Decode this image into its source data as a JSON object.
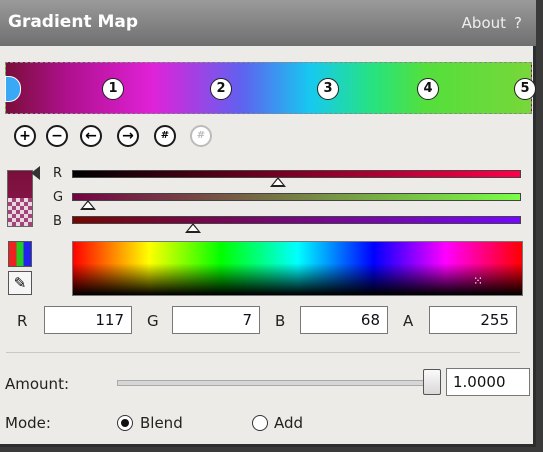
{
  "titlebar": {
    "title": "Gradient Map",
    "about": "About",
    "help": "?"
  },
  "gradient": {
    "stops": [
      "1",
      "2",
      "3",
      "4",
      "5"
    ]
  },
  "toolbar": {
    "icons": [
      "add-stop-icon",
      "remove-stop-icon",
      "move-left-icon",
      "move-right-icon",
      "distribute-icon",
      "disabled-icon"
    ]
  },
  "channels": {
    "r_label": "R",
    "g_label": "G",
    "b_label": "B"
  },
  "rgba": {
    "r_label": "R",
    "r_value": "117",
    "g_label": "G",
    "g_value": "7",
    "b_label": "B",
    "b_value": "68",
    "a_label": "A",
    "a_value": "255"
  },
  "amount": {
    "label": "Amount:",
    "value": "1.0000",
    "slider_fraction": 1.0
  },
  "mode": {
    "label": "Mode:",
    "blend_label": "Blend",
    "add_label": "Add",
    "selected": "Blend"
  }
}
